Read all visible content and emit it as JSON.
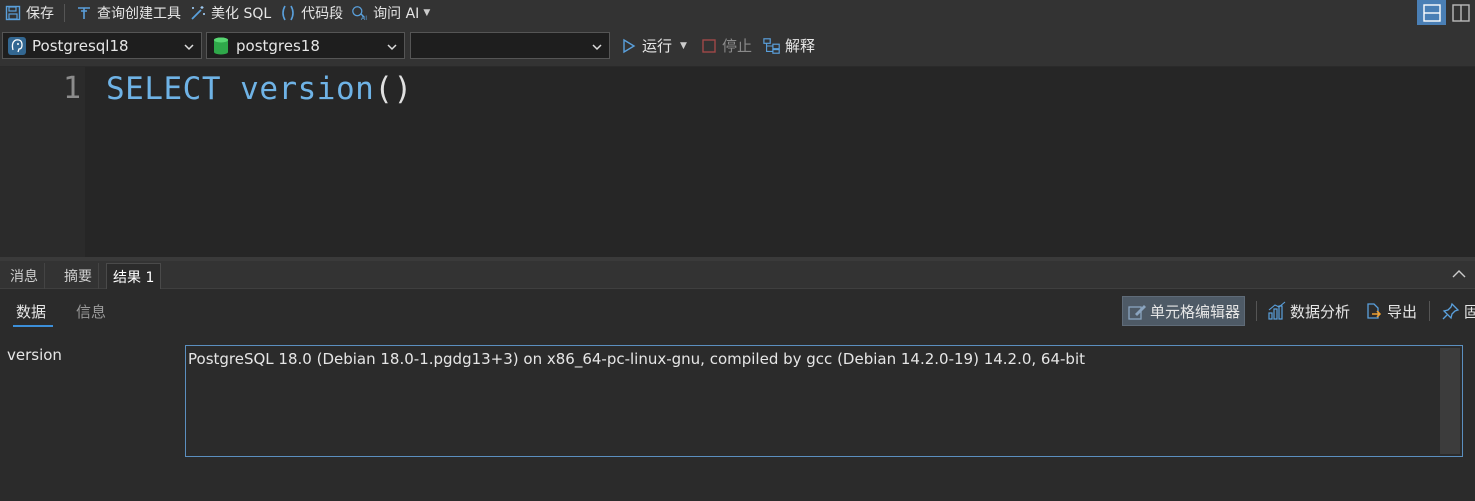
{
  "toolbar": {
    "save_label": "保存",
    "query_builder_label": "查询创建工具",
    "beautify_label": "美化 SQL",
    "snippet_label": "代码段",
    "ask_ai_label": "询问 AI"
  },
  "connection": {
    "server": "Postgresql18",
    "database": "postgres18",
    "schema": ""
  },
  "actions": {
    "run_label": "运行",
    "stop_label": "停止",
    "explain_label": "解释"
  },
  "editor": {
    "line_number": "1",
    "keyword": "SELECT",
    "function": "version",
    "parens": "()"
  },
  "result_tabs": {
    "messages": "消息",
    "summary": "摘要",
    "result1": "结果 1"
  },
  "result_view": {
    "data_tab": "数据",
    "info_tab": "信息",
    "cell_editor_label": "单元格编辑器",
    "data_analysis_label": "数据分析",
    "export_label": "导出",
    "pin_label": "固"
  },
  "record": {
    "field_name": "version",
    "field_value": "PostgreSQL 18.0 (Debian 18.0-1.pgdg13+3) on x86_64-pc-linux-gnu, compiled by gcc (Debian 14.2.0-19) 14.2.0, 64-bit"
  },
  "colors": {
    "accent": "#3c8fd9",
    "keyword": "#6fb3e6",
    "background": "#2b2b2b",
    "toolbar": "#333333"
  },
  "icons": {
    "save": "save-icon",
    "query_builder": "query-builder-icon",
    "beautify": "magic-wand-icon",
    "snippet": "parentheses-icon",
    "ask_ai": "ai-assistant-icon",
    "run": "play-icon",
    "stop": "stop-icon",
    "explain": "explain-icon",
    "cell_editor": "edit-icon",
    "data_analysis": "bar-chart-icon",
    "export": "export-icon",
    "pin": "pin-icon"
  }
}
